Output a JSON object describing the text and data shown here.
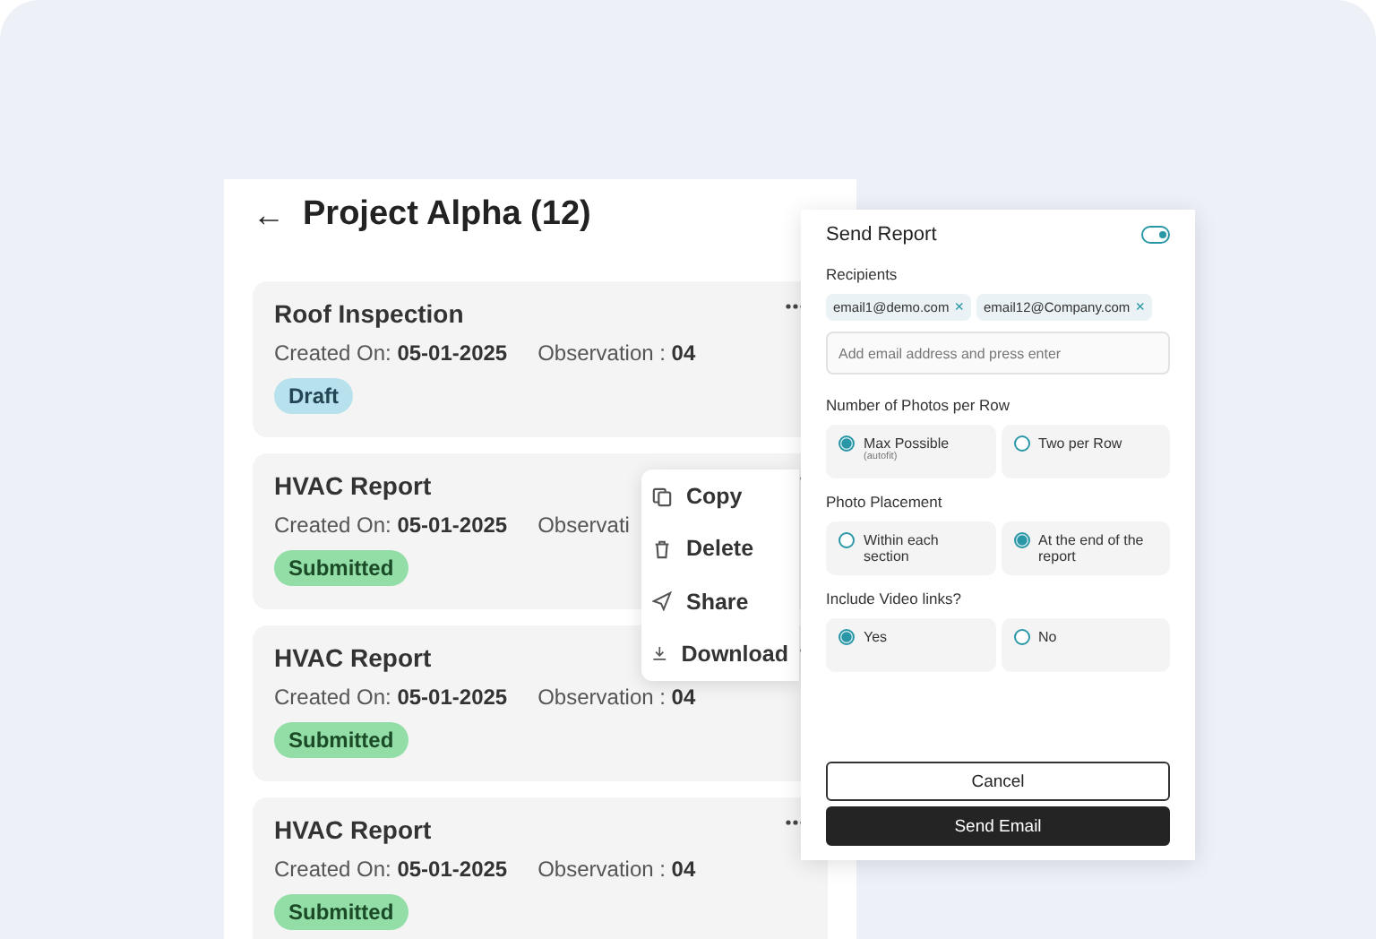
{
  "project": {
    "back_icon": "←",
    "title": "Project Alpha (12)"
  },
  "reports": [
    {
      "title": "Roof Inspection",
      "created": "Created On: **05-01-2025**",
      "observation": "Observation : **04**",
      "status": "Draft",
      "kind": "draft"
    },
    {
      "title": "HVAC Report",
      "created": "Created On: **05-01-2025**",
      "observation": "Observati",
      "status": "Submitted",
      "kind": "submitted"
    },
    {
      "title": "HVAC Report",
      "created": "Created On: **05-01-2025**",
      "observation": "Observation : **04**",
      "status": "Submitted",
      "kind": "submitted"
    },
    {
      "title": "HVAC Report",
      "created": "Created On: **05-01-2025**",
      "observation": "Observation : **04**",
      "status": "Submitted",
      "kind": "submitted"
    }
  ],
  "context_menu": [
    {
      "label": "Copy",
      "kind": "copy"
    },
    {
      "label": "Delete",
      "kind": "delete"
    },
    {
      "label": "Share",
      "kind": "share"
    },
    {
      "label": "Download",
      "kind": "download"
    }
  ],
  "send_report": {
    "title": "Send Report",
    "toggle": {
      "on": true
    },
    "recipients_label": "Recipients",
    "recipients": [
      {
        "email": "email1@demo.com",
        "remove": "×"
      },
      {
        "email": "email12@Company.com",
        "remove": "×"
      }
    ],
    "email_field": {
      "placeholder": "Add email address and press enter"
    },
    "groups": [
      {
        "label": "Number of Photos per Row",
        "options": [
          {
            "label": "Max Possible",
            "note": "(autofit)",
            "selected": true
          },
          {
            "label": "Two per Row",
            "selected": false
          }
        ]
      },
      {
        "label": "Photo Placement",
        "options": [
          {
            "label": "Within each section",
            "selected": false
          },
          {
            "label": "At the end of the report",
            "selected": true
          }
        ]
      },
      {
        "label": "Include Video links?",
        "options": [
          {
            "label": "Yes",
            "selected": true
          },
          {
            "label": "No",
            "selected": false
          }
        ]
      }
    ],
    "buttons": [
      {
        "label": "Cancel",
        "kind": "secondary"
      },
      {
        "label": "Send Email",
        "kind": "primary"
      }
    ]
  }
}
